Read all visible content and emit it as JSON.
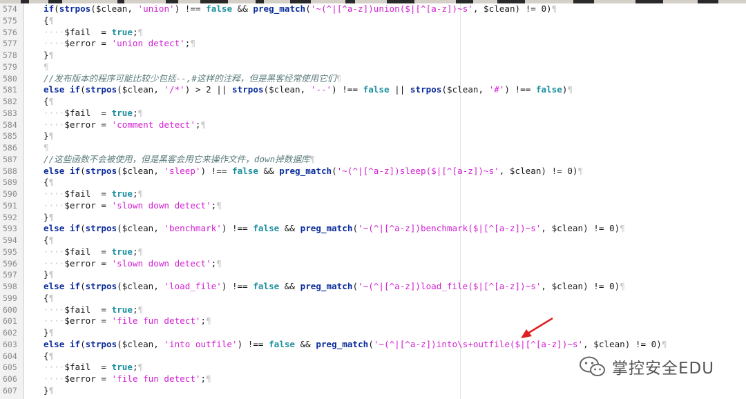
{
  "editor": {
    "lines": [
      {
        "n": "574",
        "indent": 0,
        "tokens": [
          [
            "kw",
            "if"
          ],
          [
            "op",
            "("
          ],
          [
            "fn",
            "strpos"
          ],
          [
            "op",
            "("
          ],
          [
            "var",
            "$clean"
          ],
          [
            "op",
            ", "
          ],
          [
            "str",
            "'union'"
          ],
          [
            "op",
            ") "
          ],
          [
            "op",
            "!=="
          ],
          [
            "op",
            " "
          ],
          [
            "cst",
            "false"
          ],
          [
            "op",
            " && "
          ],
          [
            "fn",
            "preg_match"
          ],
          [
            "op",
            "("
          ],
          [
            "str",
            "'~(^|[^a-z])union($|[^[a-z])~s'"
          ],
          [
            "op",
            ", "
          ],
          [
            "var",
            "$clean"
          ],
          [
            "op",
            ") "
          ],
          [
            "op",
            "!= 0)"
          ]
        ]
      },
      {
        "n": "575",
        "indent": 0,
        "tokens": [
          [
            "op",
            "{"
          ]
        ]
      },
      {
        "n": "576",
        "indent": 1,
        "tokens": [
          [
            "var",
            "$fail"
          ],
          [
            "op",
            "  = "
          ],
          [
            "cst",
            "true"
          ],
          [
            "op",
            ";"
          ]
        ]
      },
      {
        "n": "577",
        "indent": 1,
        "tokens": [
          [
            "var",
            "$error"
          ],
          [
            "op",
            " = "
          ],
          [
            "str",
            "'union detect'"
          ],
          [
            "op",
            ";"
          ]
        ]
      },
      {
        "n": "578",
        "indent": 0,
        "tokens": [
          [
            "op",
            "}"
          ]
        ]
      },
      {
        "n": "579",
        "indent": 0,
        "tokens": []
      },
      {
        "n": "580",
        "indent": 0,
        "tokens": [
          [
            "cmt",
            "//发布版本的程序可能比较少包括--,#这样的注释，但是黑客经常使用它们"
          ]
        ]
      },
      {
        "n": "581",
        "indent": 0,
        "tokens": [
          [
            "kw",
            "else if"
          ],
          [
            "op",
            "("
          ],
          [
            "fn",
            "strpos"
          ],
          [
            "op",
            "("
          ],
          [
            "var",
            "$clean"
          ],
          [
            "op",
            ", "
          ],
          [
            "str",
            "'/*'"
          ],
          [
            "op",
            ") > 2 || "
          ],
          [
            "fn",
            "strpos"
          ],
          [
            "op",
            "("
          ],
          [
            "var",
            "$clean"
          ],
          [
            "op",
            ", "
          ],
          [
            "str",
            "'--'"
          ],
          [
            "op",
            ") !== "
          ],
          [
            "cst",
            "false"
          ],
          [
            "op",
            " || "
          ],
          [
            "fn",
            "strpos"
          ],
          [
            "op",
            "("
          ],
          [
            "var",
            "$clean"
          ],
          [
            "op",
            ", "
          ],
          [
            "str",
            "'#'"
          ],
          [
            "op",
            ") !== "
          ],
          [
            "cst",
            "false"
          ],
          [
            "op",
            ")"
          ]
        ]
      },
      {
        "n": "582",
        "indent": 0,
        "tokens": [
          [
            "op",
            "{"
          ]
        ]
      },
      {
        "n": "583",
        "indent": 1,
        "tokens": [
          [
            "var",
            "$fail"
          ],
          [
            "op",
            "  = "
          ],
          [
            "cst",
            "true"
          ],
          [
            "op",
            ";"
          ]
        ]
      },
      {
        "n": "584",
        "indent": 1,
        "tokens": [
          [
            "var",
            "$error"
          ],
          [
            "op",
            " = "
          ],
          [
            "str",
            "'comment detect'"
          ],
          [
            "op",
            ";"
          ]
        ]
      },
      {
        "n": "585",
        "indent": 0,
        "tokens": [
          [
            "op",
            "}"
          ]
        ]
      },
      {
        "n": "586",
        "indent": 0,
        "tokens": []
      },
      {
        "n": "587",
        "indent": 0,
        "tokens": [
          [
            "cmt",
            "//这些函数不会被使用，但是黑客会用它来操作文件，down掉数据库"
          ]
        ]
      },
      {
        "n": "588",
        "indent": 0,
        "tokens": [
          [
            "kw",
            "else if"
          ],
          [
            "op",
            "("
          ],
          [
            "fn",
            "strpos"
          ],
          [
            "op",
            "("
          ],
          [
            "var",
            "$clean"
          ],
          [
            "op",
            ", "
          ],
          [
            "str",
            "'sleep'"
          ],
          [
            "op",
            ") !== "
          ],
          [
            "cst",
            "false"
          ],
          [
            "op",
            " && "
          ],
          [
            "fn",
            "preg_match"
          ],
          [
            "op",
            "("
          ],
          [
            "str",
            "'~(^|[^a-z])sleep($|[^[a-z])~s'"
          ],
          [
            "op",
            ", "
          ],
          [
            "var",
            "$clean"
          ],
          [
            "op",
            ") != 0)"
          ]
        ]
      },
      {
        "n": "589",
        "indent": 0,
        "tokens": [
          [
            "op",
            "{"
          ]
        ]
      },
      {
        "n": "590",
        "indent": 1,
        "tokens": [
          [
            "var",
            "$fail"
          ],
          [
            "op",
            "  = "
          ],
          [
            "cst",
            "true"
          ],
          [
            "op",
            ";"
          ]
        ]
      },
      {
        "n": "591",
        "indent": 1,
        "tokens": [
          [
            "var",
            "$error"
          ],
          [
            "op",
            " = "
          ],
          [
            "str",
            "'slown down detect'"
          ],
          [
            "op",
            ";"
          ]
        ]
      },
      {
        "n": "592",
        "indent": 0,
        "tokens": [
          [
            "op",
            "}"
          ]
        ]
      },
      {
        "n": "593",
        "indent": 0,
        "tokens": [
          [
            "kw",
            "else if"
          ],
          [
            "op",
            "("
          ],
          [
            "fn",
            "strpos"
          ],
          [
            "op",
            "("
          ],
          [
            "var",
            "$clean"
          ],
          [
            "op",
            ", "
          ],
          [
            "str",
            "'benchmark'"
          ],
          [
            "op",
            ") !== "
          ],
          [
            "cst",
            "false"
          ],
          [
            "op",
            " && "
          ],
          [
            "fn",
            "preg_match"
          ],
          [
            "op",
            "("
          ],
          [
            "str",
            "'~(^|[^a-z])benchmark($|[^[a-z])~s'"
          ],
          [
            "op",
            ", "
          ],
          [
            "var",
            "$clean"
          ],
          [
            "op",
            ") != 0)"
          ]
        ]
      },
      {
        "n": "594",
        "indent": 0,
        "tokens": [
          [
            "op",
            "{"
          ]
        ]
      },
      {
        "n": "595",
        "indent": 1,
        "tokens": [
          [
            "var",
            "$fail"
          ],
          [
            "op",
            "  = "
          ],
          [
            "cst",
            "true"
          ],
          [
            "op",
            ";"
          ]
        ]
      },
      {
        "n": "596",
        "indent": 1,
        "tokens": [
          [
            "var",
            "$error"
          ],
          [
            "op",
            " = "
          ],
          [
            "str",
            "'slown down detect'"
          ],
          [
            "op",
            ";"
          ]
        ]
      },
      {
        "n": "597",
        "indent": 0,
        "tokens": [
          [
            "op",
            "}"
          ]
        ]
      },
      {
        "n": "598",
        "indent": 0,
        "tokens": [
          [
            "kw",
            "else if"
          ],
          [
            "op",
            "("
          ],
          [
            "fn",
            "strpos"
          ],
          [
            "op",
            "("
          ],
          [
            "var",
            "$clean"
          ],
          [
            "op",
            ", "
          ],
          [
            "str",
            "'load_file'"
          ],
          [
            "op",
            ") !== "
          ],
          [
            "cst",
            "false"
          ],
          [
            "op",
            " && "
          ],
          [
            "fn",
            "preg_match"
          ],
          [
            "op",
            "("
          ],
          [
            "str",
            "'~(^|[^a-z])load_file($|[^[a-z])~s'"
          ],
          [
            "op",
            ", "
          ],
          [
            "var",
            "$clean"
          ],
          [
            "op",
            ") != 0)"
          ]
        ]
      },
      {
        "n": "599",
        "indent": 0,
        "tokens": [
          [
            "op",
            "{"
          ]
        ]
      },
      {
        "n": "600",
        "indent": 1,
        "tokens": [
          [
            "var",
            "$fail"
          ],
          [
            "op",
            "  = "
          ],
          [
            "cst",
            "true"
          ],
          [
            "op",
            ";"
          ]
        ]
      },
      {
        "n": "601",
        "indent": 1,
        "tokens": [
          [
            "var",
            "$error"
          ],
          [
            "op",
            " = "
          ],
          [
            "str",
            "'file fun detect'"
          ],
          [
            "op",
            ";"
          ]
        ]
      },
      {
        "n": "602",
        "indent": 0,
        "tokens": [
          [
            "op",
            "}"
          ]
        ]
      },
      {
        "n": "603",
        "indent": 0,
        "tokens": [
          [
            "kw",
            "else if"
          ],
          [
            "op",
            "("
          ],
          [
            "fn",
            "strpos"
          ],
          [
            "op",
            "("
          ],
          [
            "var",
            "$clean"
          ],
          [
            "op",
            ", "
          ],
          [
            "str",
            "'into outfile'"
          ],
          [
            "op",
            ") !== "
          ],
          [
            "cst",
            "false"
          ],
          [
            "op",
            " && "
          ],
          [
            "fn",
            "preg_match"
          ],
          [
            "op",
            "("
          ],
          [
            "str",
            "'~(^|[^a-z])into\\s+outfile($|[^[a-z])~s'"
          ],
          [
            "op",
            ", "
          ],
          [
            "var",
            "$clean"
          ],
          [
            "op",
            ") != 0)"
          ]
        ]
      },
      {
        "n": "604",
        "indent": 0,
        "tokens": [
          [
            "op",
            "{"
          ]
        ]
      },
      {
        "n": "605",
        "indent": 1,
        "tokens": [
          [
            "var",
            "$fail"
          ],
          [
            "op",
            "  = "
          ],
          [
            "cst",
            "true"
          ],
          [
            "op",
            ";"
          ]
        ]
      },
      {
        "n": "606",
        "indent": 1,
        "tokens": [
          [
            "var",
            "$error"
          ],
          [
            "op",
            " = "
          ],
          [
            "str",
            "'file fun detect'"
          ],
          [
            "op",
            ";"
          ]
        ]
      },
      {
        "n": "607",
        "indent": 0,
        "tokens": [
          [
            "op",
            "}"
          ]
        ]
      }
    ]
  },
  "watermark": {
    "text": "掌控安全EDU",
    "icon": "wechat-icon"
  },
  "colors": {
    "keyword": "#0b2c9c",
    "string": "#d21ed2",
    "constant": "#1b8fa0",
    "comment": "#5c7c7c",
    "arrow": "#e02020"
  }
}
